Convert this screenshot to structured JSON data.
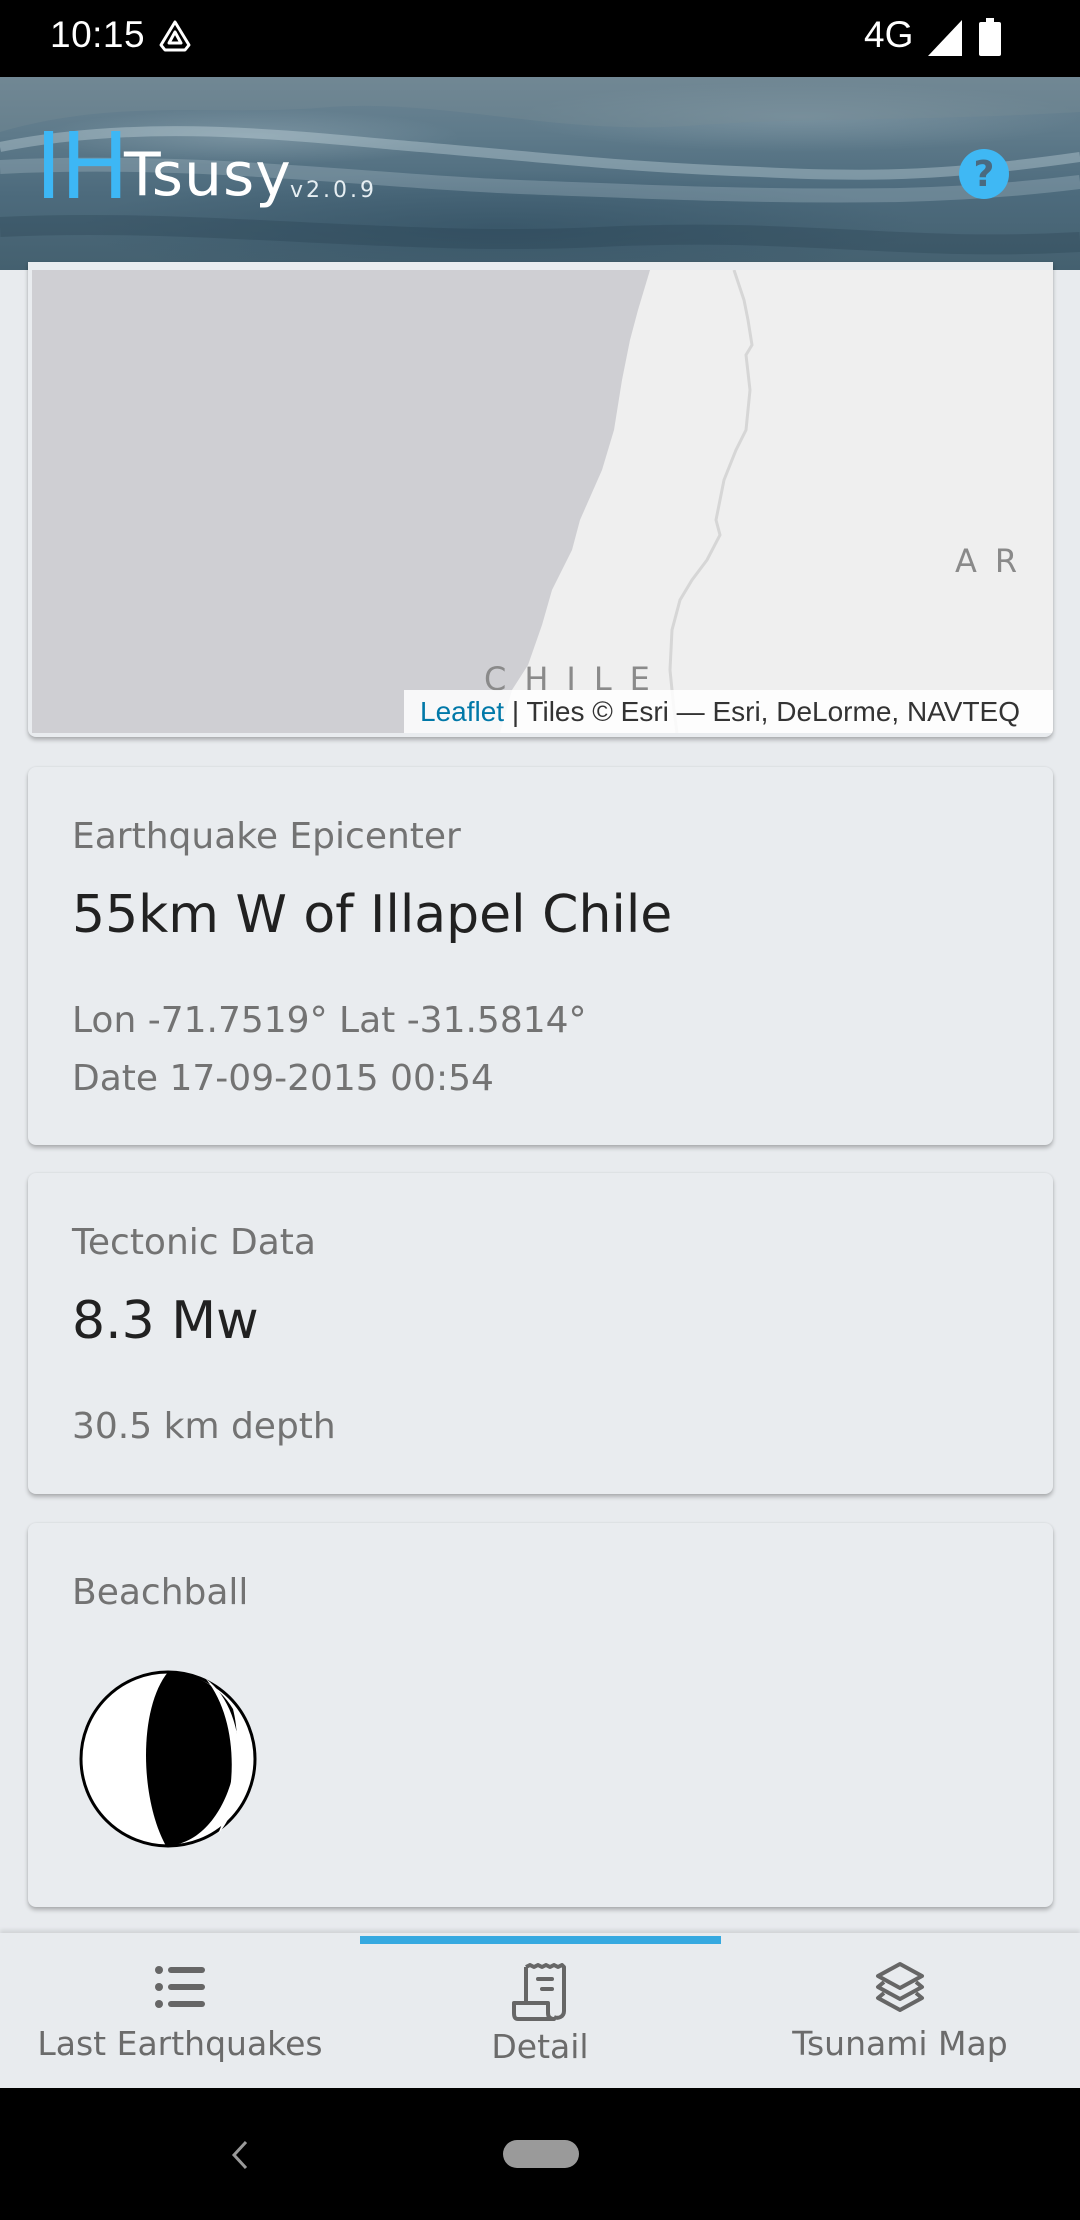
{
  "status_bar": {
    "time": "10:15",
    "app_icon": "arrow-triangle-icon",
    "network": "4G",
    "signal_icon": "cell-signal-icon",
    "battery_icon": "battery-icon"
  },
  "header": {
    "brand_prefix": "IH",
    "brand_name": "Tsusy",
    "version": "v2.0.9",
    "help_label": "?",
    "brand_color": "#3db7f5"
  },
  "map": {
    "labels": [
      "CHILE",
      "ARG"
    ],
    "label_chile": "CHILE",
    "label_arg": "AR",
    "attribution_link": "Leaflet",
    "attribution_text": " | Tiles © Esri — Esri, DeLorme, NAVTEQ",
    "ocean_color": "#cfcfd3",
    "land_color": "#efefef"
  },
  "epicenter": {
    "label": "Earthquake Epicenter",
    "location": "55km W of Illapel Chile",
    "coords": "Lon -71.7519° Lat -31.5814°",
    "lon": "-71.7519°",
    "lat": "-31.5814°",
    "date": "Date 17-09-2015 00:54"
  },
  "tectonic": {
    "label": "Tectonic Data",
    "magnitude": "8.3 Mw",
    "depth": "30.5 km depth"
  },
  "beachball": {
    "label": "Beachball",
    "icon": "focal-mechanism-beachball"
  },
  "bottom_nav": {
    "active_index": 1,
    "accent_color": "#36a9e0",
    "items": [
      {
        "label": "Last Earthquakes",
        "icon": "list-icon"
      },
      {
        "label": "Detail",
        "icon": "receipt-icon"
      },
      {
        "label": "Tsunami Map",
        "icon": "layers-icon"
      }
    ]
  },
  "system_nav": {
    "back_icon": "back-chevron-icon",
    "home_icon": "home-pill-icon"
  }
}
